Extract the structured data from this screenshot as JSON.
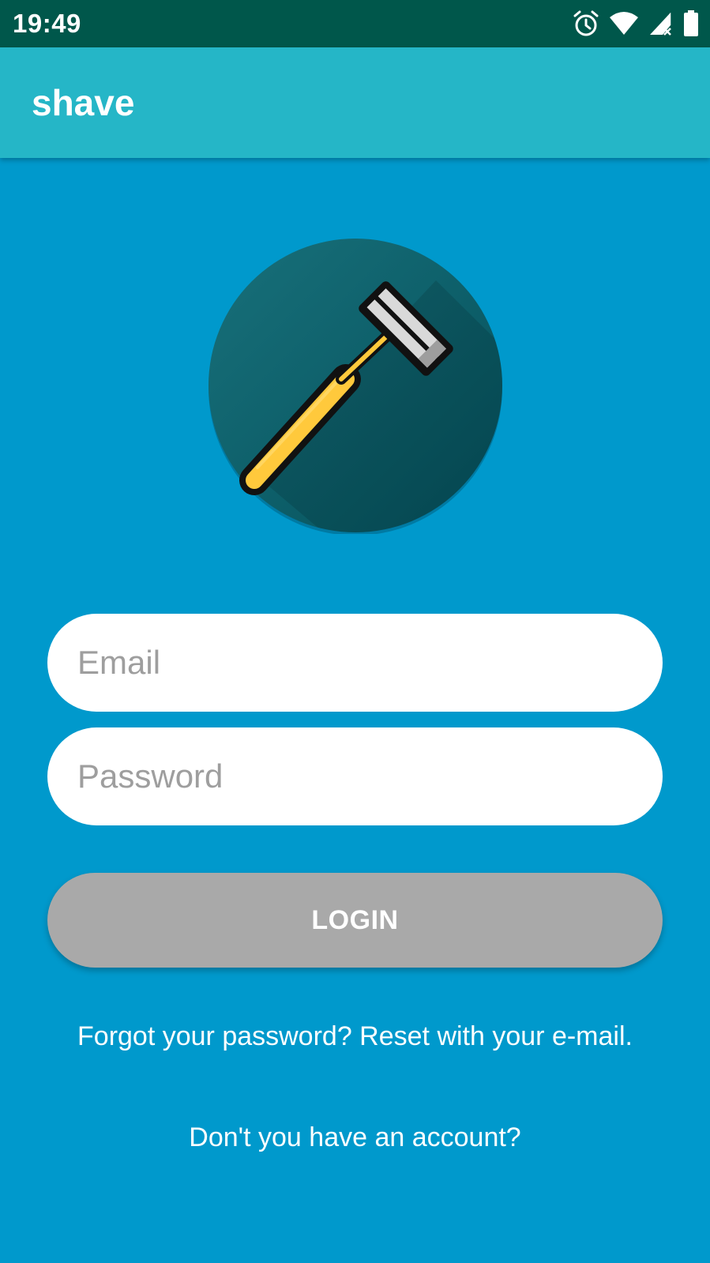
{
  "status_bar": {
    "time": "19:49",
    "icons": [
      "alarm-icon",
      "wifi-icon",
      "signal-icon",
      "battery-icon"
    ]
  },
  "app_bar": {
    "title": "shave",
    "color": "#25B6C7"
  },
  "logo": {
    "icon": "razor-icon"
  },
  "form": {
    "email_placeholder": "Email",
    "email_value": "",
    "password_placeholder": "Password",
    "password_value": "",
    "login_label": "LOGIN",
    "forgot_text": "Forgot your password? Reset with your e-mail.",
    "signup_text": "Don't you have an account?"
  },
  "colors": {
    "status_bar": "#00574B",
    "background": "#0099CC",
    "logo_circle": "#0F5E6A",
    "razor_handle": "#FFC93C",
    "button_disabled": "#A9A9A9"
  }
}
